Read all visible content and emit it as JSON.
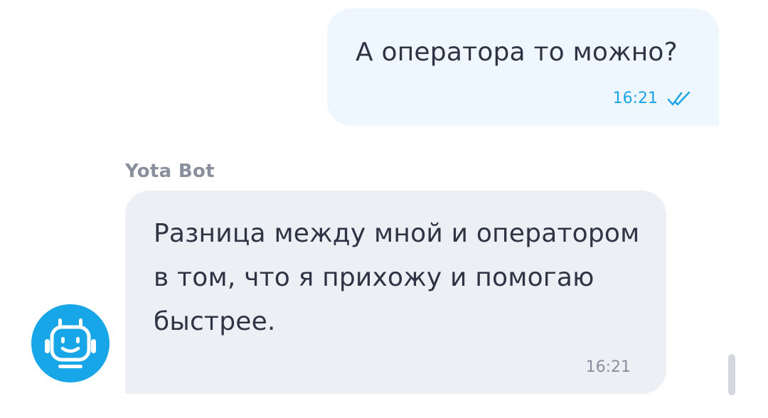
{
  "messages": {
    "outgoing": {
      "text": "А оператора то можно?",
      "time": "16:21",
      "status_icon": "double-check-icon",
      "bubble_color": "#edf7fd",
      "accent_color": "#1aa4e6"
    },
    "incoming": {
      "sender": "Yota Bot",
      "text": "Разница между мной и оператором в том, что я прихожу и помогаю быстрее.",
      "time": "16:21",
      "avatar_icon": "robot-icon",
      "bubble_color": "#eceff4",
      "avatar_color": "#17a6e8"
    }
  }
}
